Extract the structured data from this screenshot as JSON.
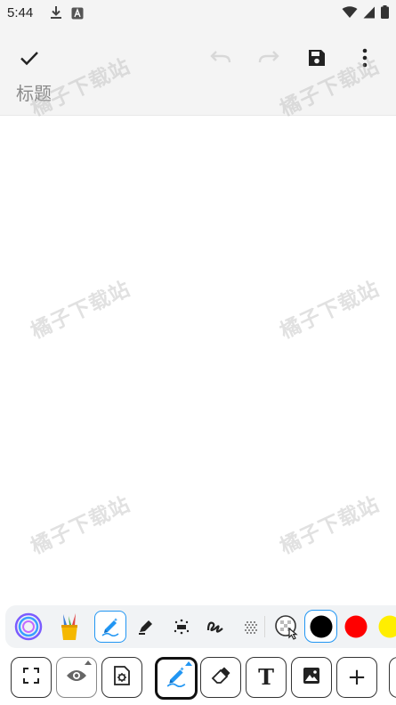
{
  "status_bar": {
    "time": "5:44",
    "icons_left": [
      "download-icon",
      "app-a-icon"
    ],
    "icons_right": [
      "wifi-icon",
      "cellular-signal-icon",
      "battery-icon"
    ]
  },
  "toolbar": {
    "confirm_icon": "check-icon",
    "undo_icon": "undo-icon",
    "redo_icon": "redo-icon",
    "save_icon": "save-icon",
    "more_icon": "more-vert-icon",
    "title_placeholder": "标题",
    "title_value": ""
  },
  "watermark": {
    "text": "橘子下载站"
  },
  "pen_tray": {
    "items": [
      {
        "icon": "ring-icon"
      },
      {
        "icon": "pen-holder-icon"
      },
      {
        "icon": "ai-pen-icon",
        "selected": true
      },
      {
        "icon": "marker-icon"
      },
      {
        "icon": "dotted-brush-icon"
      },
      {
        "icon": "squiggle-brush-icon"
      },
      {
        "icon": "spray-icon"
      },
      {
        "icon": "color-picker-icon"
      }
    ],
    "colors": [
      "#000000",
      "#ff0000",
      "#ffee00"
    ],
    "selected_color": "#000000"
  },
  "bottom_tools": [
    {
      "icon": "fullscreen-icon"
    },
    {
      "icon": "eye-icon"
    },
    {
      "icon": "settings-page-icon"
    },
    {
      "icon": "pen-tool-icon",
      "active": true
    },
    {
      "icon": "eraser-icon"
    },
    {
      "icon": "text-tool-icon",
      "glyph": "T"
    },
    {
      "icon": "image-icon"
    },
    {
      "icon": "add-icon",
      "glyph": "+"
    }
  ],
  "colors": {
    "accent": "#2196f3",
    "bar_bg": "#f4f4f4",
    "tray_bg": "#f1f3f5"
  }
}
